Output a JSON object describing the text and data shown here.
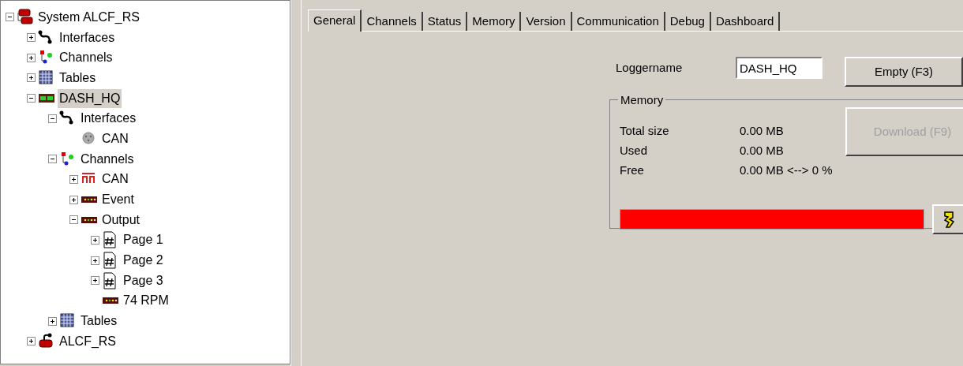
{
  "tree": [
    {
      "label": "System ALCF_RS",
      "kind": "system",
      "expanded": true,
      "selected": false,
      "children": [
        {
          "label": "Interfaces",
          "kind": "interfaces",
          "expanded": false,
          "selected": false
        },
        {
          "label": "Channels",
          "kind": "channels",
          "expanded": false,
          "selected": false
        },
        {
          "label": "Tables",
          "kind": "tables",
          "expanded": false,
          "selected": false
        },
        {
          "label": "DASH_HQ",
          "kind": "logger",
          "expanded": true,
          "selected": true,
          "children": [
            {
              "label": "Interfaces",
              "kind": "interfaces",
              "expanded": true,
              "selected": false,
              "children": [
                {
                  "label": "CAN",
                  "kind": "port",
                  "selected": false
                }
              ]
            },
            {
              "label": "Channels",
              "kind": "channels",
              "expanded": true,
              "selected": false,
              "children": [
                {
                  "label": "CAN",
                  "kind": "can",
                  "expanded": false,
                  "selected": false
                },
                {
                  "label": "Event",
                  "kind": "display",
                  "expanded": false,
                  "selected": false
                },
                {
                  "label": "Output",
                  "kind": "display",
                  "expanded": true,
                  "selected": false,
                  "children": [
                    {
                      "label": "Page 1",
                      "kind": "page",
                      "expanded": false,
                      "selected": false
                    },
                    {
                      "label": "Page 2",
                      "kind": "page",
                      "expanded": false,
                      "selected": false
                    },
                    {
                      "label": "Page 3",
                      "kind": "page",
                      "expanded": false,
                      "selected": false
                    },
                    {
                      "label": "74 RPM",
                      "kind": "display",
                      "selected": false
                    }
                  ]
                }
              ]
            },
            {
              "label": "Tables",
              "kind": "tables",
              "expanded": false,
              "selected": false
            }
          ]
        },
        {
          "label": "ALCF_RS",
          "kind": "device",
          "expanded": false,
          "selected": false
        }
      ]
    }
  ],
  "tabs": [
    {
      "label": "General",
      "selected": true
    },
    {
      "label": "Channels",
      "selected": false
    },
    {
      "label": "Status",
      "selected": false
    },
    {
      "label": "Memory",
      "selected": false
    },
    {
      "label": "Version",
      "selected": false
    },
    {
      "label": "Communication",
      "selected": false
    },
    {
      "label": "Debug",
      "selected": false
    },
    {
      "label": "Dashboard",
      "selected": false
    }
  ],
  "logger_name": {
    "label": "Loggername",
    "value": "DASH_HQ"
  },
  "empty_button": {
    "label": "Empty (F3)",
    "disabled": false
  },
  "memory": {
    "title": "Memory",
    "rows": [
      {
        "label": "Total size",
        "value": "0.00 MB"
      },
      {
        "label": "Used",
        "value": "0.00 MB"
      },
      {
        "label": "Free",
        "value": "0.00 MB <--> 0 %"
      }
    ],
    "download_button": {
      "label": "Download (F9)",
      "disabled": true
    },
    "level": 1
  }
}
